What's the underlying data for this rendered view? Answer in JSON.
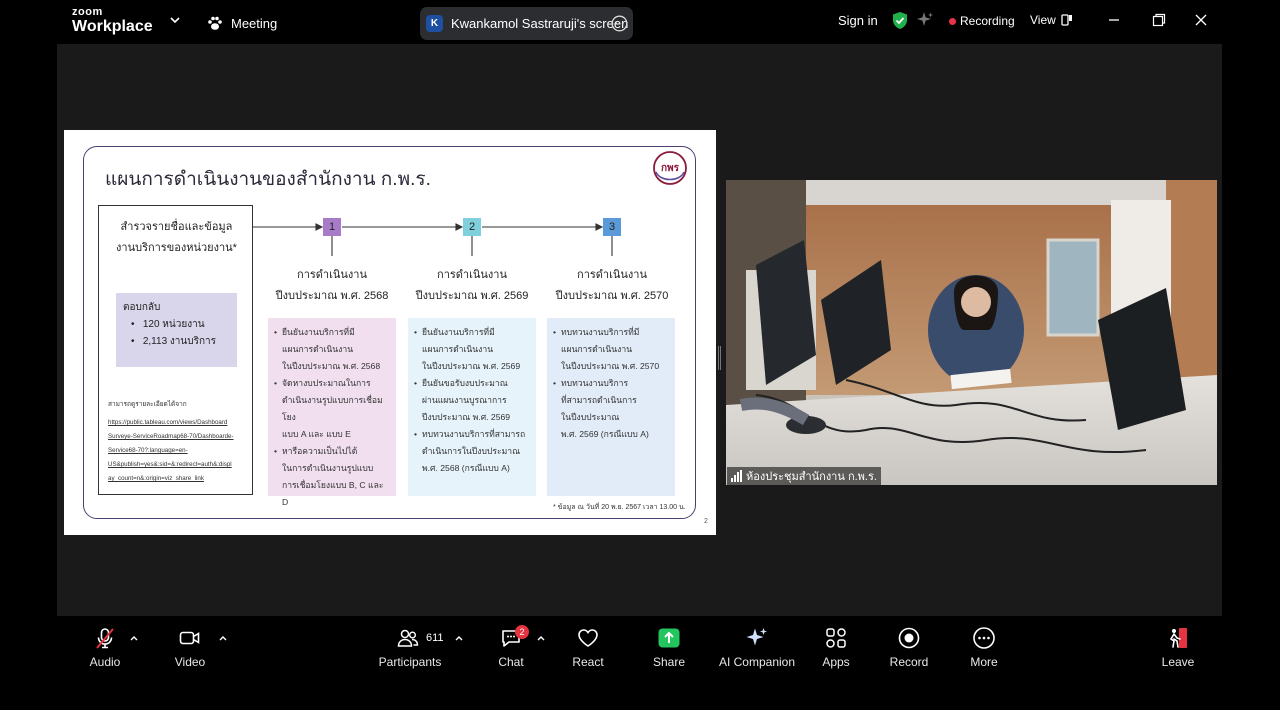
{
  "app": {
    "brand_top": "zoom",
    "brand_bottom": "Workplace",
    "meeting_label": "Meeting"
  },
  "share": {
    "avatar_letter": "K",
    "title": "Kwankamol Sastraruji's screen"
  },
  "header": {
    "signin": "Sign in",
    "recording": "Recording",
    "view": "View"
  },
  "slide": {
    "title": "แผนการดำเนินงานของสำนักงาน ก.พ.ร.",
    "logo_text": "กพร",
    "survey_line1": "สำรวจรายชื่อและข้อมูล",
    "survey_line2": "งานบริการของหน่วยงาน*",
    "response_title": "ตอบกลับ",
    "response_items": [
      "120 หน่วยงาน",
      "2,113 งานบริการ"
    ],
    "source_title": "สามารถดูรายละเอียดได้จาก",
    "source_links": [
      "https://public.tableau.com/views/Dashboard",
      "Surveye-ServiceRoadmap68-70/Dashboarde-",
      "Service68-70?:language=en-",
      "US&publish=yes&:sid=&:redirect=auth&:displ",
      "ay_count=n&:origin=viz_share_link"
    ],
    "steps": [
      {
        "num": "1",
        "caption1": "การดำเนินงาน",
        "caption2": "ปีงบประมาณ พ.ศ. 2568",
        "bullets": [
          [
            "ยืนยันงานบริการที่มี",
            "แผนการดำเนินงาน",
            "ในปีงบประมาณ พ.ศ. 2568"
          ],
          [
            "จัดหางบประมาณในการ",
            "ดำเนินงานรูปแบบการเชื่อมโยง",
            "แบบ A และ แบบ E"
          ],
          [
            "หารือความเป็นไปได้",
            "ในการดำเนินงานรูปแบบ",
            "การเชื่อมโยงแบบ B, C และ D"
          ]
        ]
      },
      {
        "num": "2",
        "caption1": "การดำเนินงาน",
        "caption2": "ปีงบประมาณ พ.ศ. 2569",
        "bullets": [
          [
            "ยืนยันงานบริการที่มี",
            "แผนการดำเนินงาน",
            "ในปีงบประมาณ พ.ศ. 2569"
          ],
          [
            "ยืนยันขอรับงบประมาณ",
            "ผ่านแผนงานบูรณาการ",
            "ปีงบประมาณ พ.ศ. 2569"
          ],
          [
            "ทบทวนงานบริการที่สามารถ",
            "ดำเนินการในปีงบประมาณ",
            "พ.ศ. 2568 (กรณีแบบ A)"
          ]
        ]
      },
      {
        "num": "3",
        "caption1": "การดำเนินงาน",
        "caption2": "ปีงบประมาณ พ.ศ. 2570",
        "bullets": [
          [
            "ทบทวนงานบริการที่มี",
            "แผนการดำเนินงาน",
            "ในปีงบประมาณ พ.ศ. 2570"
          ],
          [
            "ทบทวนงานบริการ",
            "ที่สามารถดำเนินการ",
            "ในปีงบประมาณ",
            "พ.ศ. 2569 (กรณีแบบ A)"
          ]
        ]
      }
    ],
    "footnote": "* ข้อมูล ณ วันที่ 20 พ.ย. 2567 เวลา 13.00 น.",
    "page_number": "2"
  },
  "video": {
    "participant_label": "ห้องประชุมสำนักงาน ก.พ.ร."
  },
  "toolbar": {
    "audio": "Audio",
    "video": "Video",
    "participants": "Participants",
    "participants_count": "611",
    "chat": "Chat",
    "chat_badge": "2",
    "react": "React",
    "share": "Share",
    "ai_companion": "AI Companion",
    "apps": "Apps",
    "record": "Record",
    "more": "More",
    "leave": "Leave"
  },
  "colors": {
    "step1": "#a77bc8",
    "step2": "#7fd0dc",
    "step3": "#5a9ad8",
    "box1": "#f1dff0",
    "box2": "#e6f3fa",
    "box3": "#e2ecf8",
    "share_green": "#22c55e",
    "recording_red": "#e8334a",
    "leave_red": "#e5333f"
  }
}
